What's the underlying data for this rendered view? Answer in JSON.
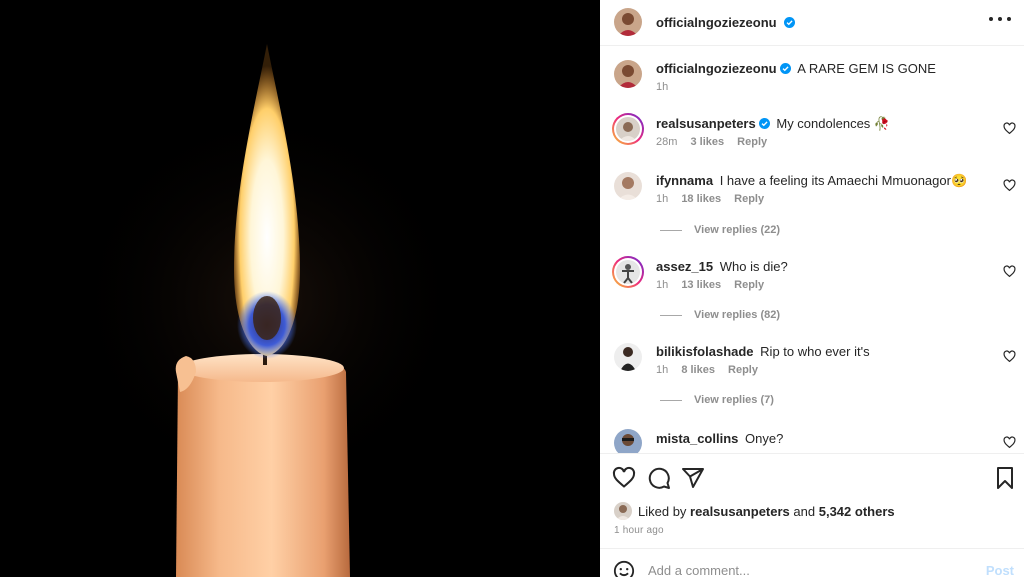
{
  "header": {
    "username": "officialngoziezeonu",
    "verified_icon": "verified-badge-icon",
    "more_icon": "more-options-icon"
  },
  "caption": {
    "username": "officialngoziezeonu",
    "text": "A RARE GEM IS GONE",
    "time": "1h"
  },
  "comments": [
    {
      "username": "realsusanpeters",
      "verified": true,
      "text": "My condolences 🥀",
      "time": "28m",
      "likes": "3 likes",
      "reply": "Reply"
    },
    {
      "username": "ifynnama",
      "verified": false,
      "text": "I have a feeling its Amaechi Mmuonagor🥺",
      "time": "1h",
      "likes": "18 likes",
      "reply": "Reply",
      "view_replies": "View replies (22)"
    },
    {
      "username": "assez_15",
      "verified": false,
      "text": "Who is die?",
      "time": "1h",
      "likes": "13 likes",
      "reply": "Reply",
      "view_replies": "View replies (82)"
    },
    {
      "username": "bilikisfolashade",
      "verified": false,
      "text": "Rip to who ever it's",
      "time": "1h",
      "likes": "8 likes",
      "reply": "Reply",
      "view_replies": "View replies (7)"
    },
    {
      "username": "mista_collins",
      "verified": false,
      "text": "Onye?"
    }
  ],
  "actions": {
    "like_icon": "heart-icon",
    "comment_icon": "comment-icon",
    "share_icon": "share-icon",
    "save_icon": "bookmark-icon"
  },
  "likes": {
    "prefix": "Liked by",
    "user": "realsusanpeters",
    "and": "and",
    "others": "5,342 others"
  },
  "timestamp": "1 hour ago",
  "comment_box": {
    "placeholder": "Add a comment...",
    "post_label": "Post"
  },
  "colors": {
    "verified": "#0095f6",
    "post_button_disabled": "#c0dffd",
    "secondary_text": "#8e8e8e"
  }
}
